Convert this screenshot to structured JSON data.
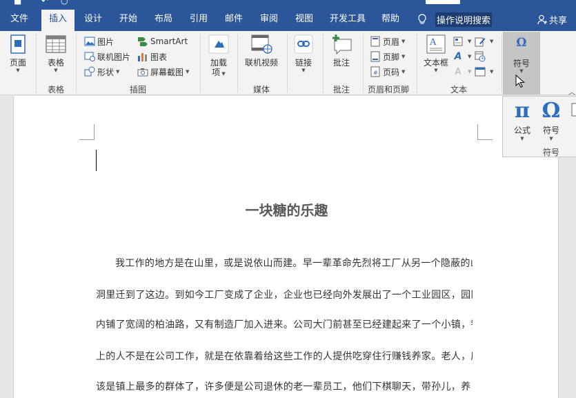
{
  "tabs": [
    "文件",
    "插入",
    "设计",
    "开始",
    "布局",
    "引用",
    "邮件",
    "审阅",
    "视图",
    "开发工具",
    "帮助"
  ],
  "active_tab": "插入",
  "tell_me": "操作说明搜索",
  "share": "共享",
  "ribbon": {
    "pages": {
      "button": "页面"
    },
    "tables": {
      "button": "表格",
      "group": "表格"
    },
    "illustrations": {
      "group": "插图",
      "picture": "图片",
      "online_picture": "联机图片",
      "shapes": "形状",
      "smartart": "SmartArt",
      "chart": "图表",
      "screenshot": "屏幕截图"
    },
    "addins": {
      "button_line1": "加载",
      "button_line2": "项"
    },
    "media": {
      "button": "联机视频",
      "group": "媒体"
    },
    "links": {
      "button": "链接"
    },
    "comments": {
      "button": "批注",
      "group": "批注"
    },
    "header_footer": {
      "group": "页眉和页脚",
      "header": "页眉",
      "footer": "页脚",
      "page_number": "页码"
    },
    "text": {
      "group": "文本",
      "textbox": "文本框"
    },
    "symbols": {
      "button": "符号"
    }
  },
  "symbol_panel": {
    "equation": "公式",
    "symbol": "符号",
    "group": "符号",
    "equation_glyph": "π",
    "symbol_glyph": "Ω"
  },
  "document": {
    "title": "一块糖的乐趣",
    "lines": [
      "我工作的地方是在山里，或是说依山而建。早一辈革命先烈将工厂从另一个隐蔽的山",
      "洞里迁到了这边。到如今工厂变成了企业，企业也已经向外发展出了一个工业园区，园区",
      "内铺了宽阔的柏油路，又有制造厂加入进来。公司大门前甚至已经建起来了一个小镇，镇",
      "上的人不是在公司工作，就是在依靠着给这些工作的人提供吃穿住行赚钱养家。老人，应",
      "该是镇上最多的群体了，许多便是公司退休的老一辈员工，他们下棋聊天，带孙儿，养"
    ]
  },
  "colors": {
    "accent": "#2b579a",
    "ribbon_bg": "#f3f3f3",
    "symbol_blue": "#2e6dbd"
  }
}
